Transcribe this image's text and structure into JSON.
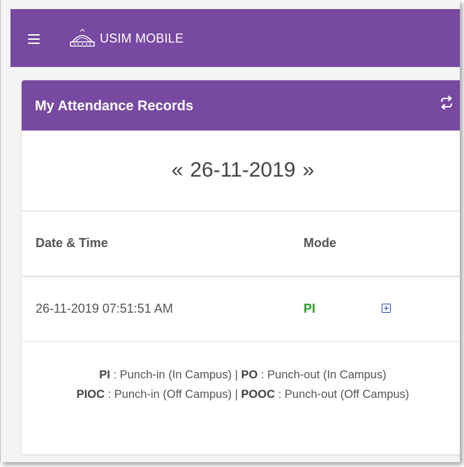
{
  "app": {
    "title": "USIM MOBILE"
  },
  "card": {
    "title": "My Attendance Records"
  },
  "date_nav": {
    "prev": "«",
    "date": "26-11-2019",
    "next": "»"
  },
  "table": {
    "headers": {
      "date_time": "Date & Time",
      "mode": "Mode"
    },
    "rows": [
      {
        "date_time": "26-11-2019 07:51:51 AM",
        "mode": "PI"
      }
    ]
  },
  "legend": {
    "pi_code": "PI",
    "pi_desc": " : Punch-in (In Campus) | ",
    "po_code": "PO",
    "po_desc": " : Punch-out (In Campus)",
    "pioc_code": "PIOC",
    "pioc_desc": " : Punch-in (Off Campus) | ",
    "pooc_code": "POOC",
    "pooc_desc": " : Punch-out (Off Campus)"
  },
  "colors": {
    "brand_purple": "#7749a0",
    "mode_green": "#2e9e2e",
    "expand_blue": "#2a4fb5"
  },
  "icons": [
    "hamburger-menu-icon",
    "usim-logo",
    "refresh-icon",
    "expand-plus-icon"
  ]
}
